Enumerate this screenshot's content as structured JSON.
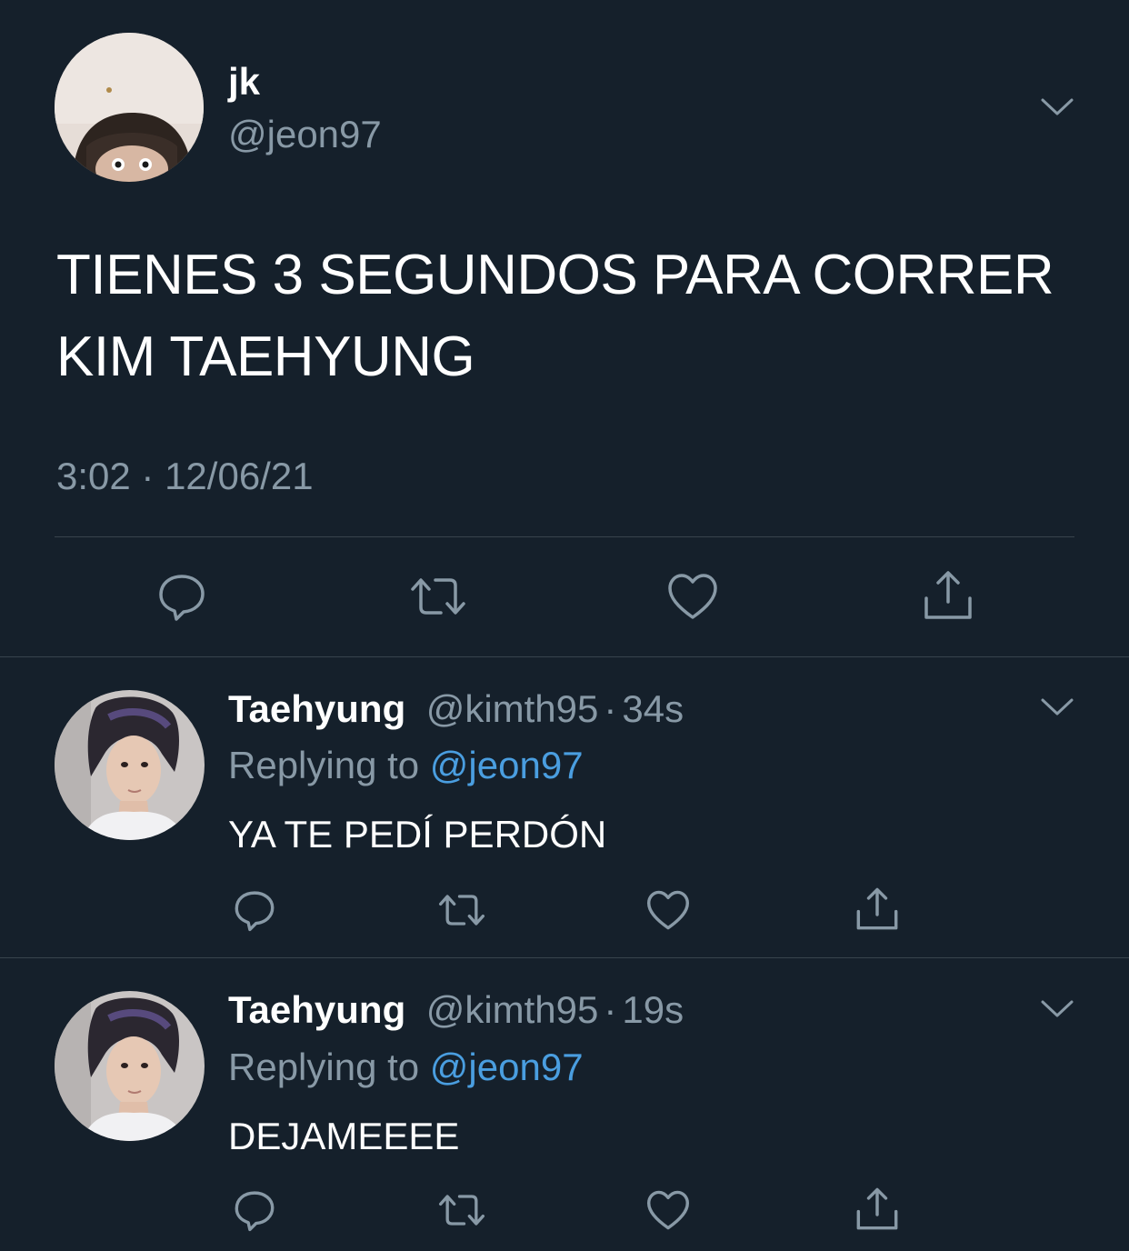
{
  "main_tweet": {
    "display_name": "jk",
    "handle": "@jeon97",
    "text": "TIENES 3 SEGUNDOS PARA CORRER KIM TAEHYUNG",
    "timestamp": "3:02 · 12/06/21",
    "actions": [
      "reply-icon",
      "retweet-icon",
      "like-icon",
      "share-icon"
    ]
  },
  "replies": [
    {
      "display_name": "Taehyung",
      "handle": "@kimth95",
      "separator": "·",
      "age": "34s",
      "replying_prefix": "Replying to",
      "replying_to": "@jeon97",
      "text": "YA TE PEDÍ PERDÓN"
    },
    {
      "display_name": "Taehyung",
      "handle": "@kimth95",
      "separator": "·",
      "age": "19s",
      "replying_prefix": "Replying to",
      "replying_to": "@jeon97",
      "text": "DEJAMEEEE"
    }
  ],
  "colors": {
    "background": "#15202b",
    "secondary_text": "#8899a6",
    "mention": "#4a9ee0",
    "divider": "#38444d"
  }
}
